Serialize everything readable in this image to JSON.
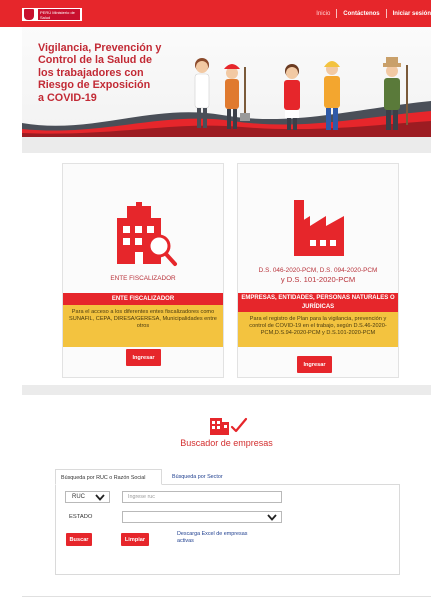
{
  "header": {
    "logo_text": "PERÚ Ministerio de Salud",
    "nav": [
      {
        "label": "Inicio"
      },
      {
        "label": "Contáctenos"
      },
      {
        "label": "Iniciar sesión"
      }
    ]
  },
  "banner": {
    "title_lines": [
      "Vigilancia, Prevención y",
      "Control de la Salud de",
      "los trabajadores con",
      "Riesgo de Exposición",
      "a COVID-19"
    ]
  },
  "cards": [
    {
      "caption": "ENTE FISCALIZADOR",
      "strip": "ENTE FISCALIZADOR",
      "description": "Para el acceso a los diferentes entes fiscalizadores como SUNAFIL, CEPA, DIRESA/GERESA, Municipalidades entre otros",
      "button": "Ingresar",
      "icon": "building-search-icon"
    },
    {
      "caption_lines": [
        "D.S. 046-2020-PCM, D.S. 094-2020-PCM",
        "y D.S. 101-2020-PCM"
      ],
      "strip": "EMPRESAS, ENTIDADES, PERSONAS NATURALES O JURÍDICAS",
      "description": "Para el registro de Plan para la vigilancia, prevención y control de COVID-19 en el trabajo, según D.S.46-2020-PCM,D.S.94-2020-PCM y D.S.101-2020-PCM",
      "button": "Ingresar",
      "icon": "factory-icon"
    }
  ],
  "finder": {
    "title": "Buscador de empresas",
    "tabs": [
      {
        "label": "Búsqueda por RUC o Razón Social",
        "active": true
      },
      {
        "label": "Búsqueda por Sector",
        "active": false
      }
    ],
    "ruc_select": "RUC",
    "ruc_placeholder": "Ingrese ruc",
    "estado_label": "ESTADO",
    "estado_value": "",
    "search_button": "Buscar",
    "clear_button": "Limpiar",
    "excel_link": "Descarga Excel de empresas activas"
  },
  "colors": {
    "brand_red": "#e6262b",
    "title_red": "#c22a35",
    "card_yellow": "#f3c33f",
    "link_blue": "#1f3f8f"
  }
}
